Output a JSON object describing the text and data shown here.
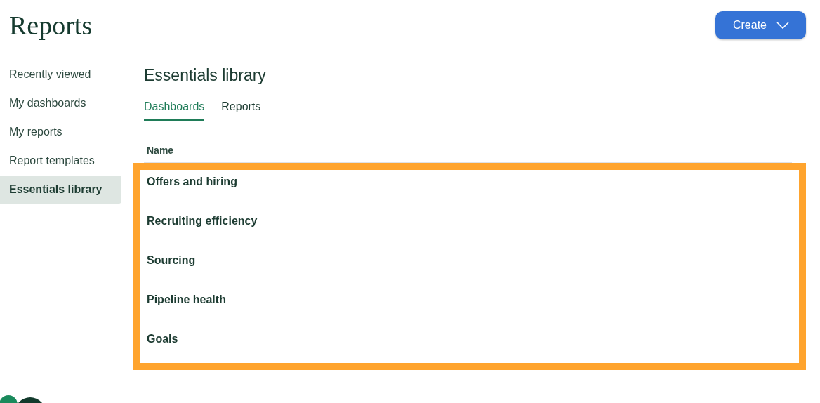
{
  "page": {
    "title": "Reports"
  },
  "create_button": {
    "label": "Create"
  },
  "sidebar": {
    "items": [
      {
        "label": "Recently viewed",
        "selected": false
      },
      {
        "label": "My dashboards",
        "selected": false
      },
      {
        "label": "My reports",
        "selected": false
      },
      {
        "label": "Report templates",
        "selected": false
      },
      {
        "label": "Essentials library",
        "selected": true
      }
    ]
  },
  "content": {
    "heading": "Essentials library",
    "tabs": [
      {
        "label": "Dashboards",
        "selected": true
      },
      {
        "label": "Reports",
        "selected": false
      }
    ],
    "table": {
      "columns": [
        "Name"
      ],
      "rows": [
        [
          "Offers and hiring"
        ],
        [
          "Recruiting efficiency"
        ],
        [
          "Sourcing"
        ],
        [
          "Pipeline health"
        ],
        [
          "Goals"
        ]
      ]
    }
  }
}
